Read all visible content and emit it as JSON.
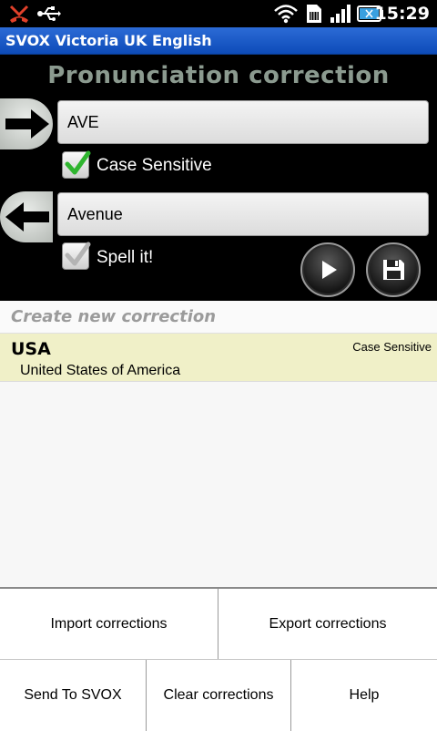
{
  "status_bar": {
    "time": "15:29",
    "icons": [
      "missed-call-icon",
      "usb-icon",
      "wifi-icon",
      "sim-icon",
      "signal-icon",
      "battery-icon"
    ]
  },
  "app": {
    "title": "SVOX Victoria UK English"
  },
  "editor": {
    "heading": "Pronunciation correction",
    "source_value": "AVE",
    "case_sensitive_label": "Case Sensitive",
    "case_sensitive_checked": true,
    "target_value": "Avenue",
    "spell_it_label": "Spell it!",
    "spell_it_checked": false
  },
  "list": {
    "create_new": "Create new correction",
    "items": [
      {
        "word": "USA",
        "replacement": "United States of America",
        "badge": "Case Sensitive"
      }
    ]
  },
  "menu": {
    "import": "Import corrections",
    "export": "Export corrections",
    "send": "Send To SVOX",
    "clear": "Clear corrections",
    "help": "Help"
  },
  "colors": {
    "title_bar": "#1556c6",
    "heading": "#8b9a8f",
    "row_highlight": "#f0f0c8",
    "check_green": "#2fb52f"
  }
}
